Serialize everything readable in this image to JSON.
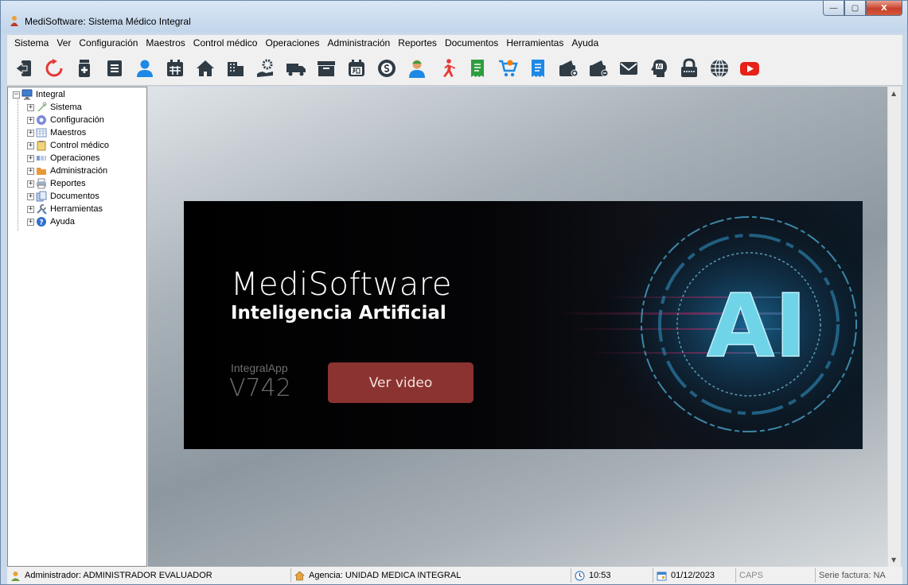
{
  "window": {
    "title": "MediSoftware: Sistema Médico Integral",
    "controls": {
      "minimize": "—",
      "maximize": "▢",
      "close": "X"
    }
  },
  "menubar": {
    "items": [
      "Sistema",
      "Ver",
      "Configuración",
      "Maestros",
      "Control médico",
      "Operaciones",
      "Administración",
      "Reportes",
      "Documentos",
      "Herramientas",
      "Ayuda"
    ]
  },
  "toolbar": {
    "icons": [
      "exit-icon",
      "refresh-icon",
      "medicine-icon",
      "checklist-icon",
      "user-icon",
      "calendar-icon",
      "home-icon",
      "building-icon",
      "hand-gear-icon",
      "truck-icon",
      "archive-icon",
      "calendar-30-icon",
      "money-icon",
      "doctor-icon",
      "runner-icon",
      "receipt-icon",
      "cart-icon",
      "document-icon",
      "wallet-in-icon",
      "wallet-out-icon",
      "mail-icon",
      "ai-head-icon",
      "lock-icon",
      "globe-icon",
      "youtube-icon"
    ],
    "colors": {
      "dark": "#2f3b45",
      "blue": "#1e88e5",
      "red": "#e53935",
      "green": "#2e9d3f",
      "orange": "#f57c00",
      "youtube": "#e62117"
    }
  },
  "tree": {
    "root": "Integral",
    "expand_symbol": "+",
    "collapse_symbol": "−",
    "items": [
      "Sistema",
      "Configuración",
      "Maestros",
      "Control médico",
      "Operaciones",
      "Administración",
      "Reportes",
      "Documentos",
      "Herramientas",
      "Ayuda"
    ]
  },
  "banner": {
    "brand": "MediSoftware",
    "subtitle": "Inteligencia Artificial",
    "app_name": "IntegralApp",
    "version": "V742",
    "button": "Ver video",
    "art_text": "AI"
  },
  "statusbar": {
    "user": "Administrador: ADMINISTRADOR EVALUADOR",
    "agency": "Agencia: UNIDAD MEDICA INTEGRAL",
    "time": "10:53",
    "date": "01/12/2023",
    "caps": "CAPS",
    "invoice_series": "Serie factura: NA"
  }
}
